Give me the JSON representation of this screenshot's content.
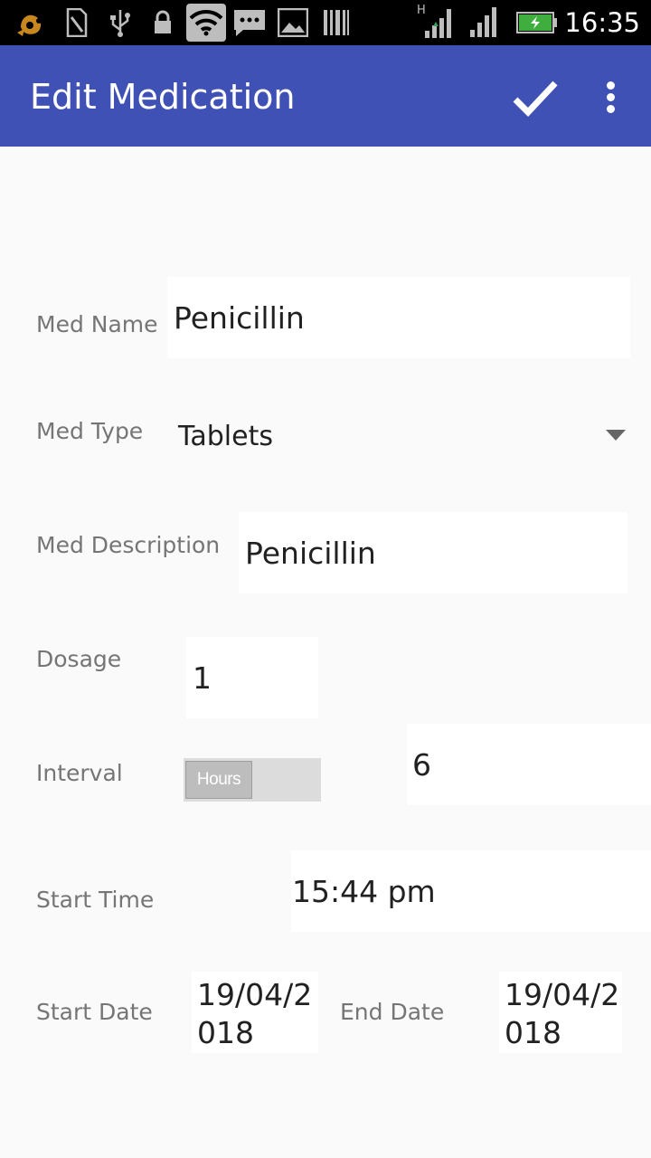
{
  "status_bar": {
    "time": "16:35",
    "icons": [
      "uc-browser-icon",
      "sim-card-icon",
      "usb-icon",
      "lock-icon",
      "wifi-icon",
      "message-icon",
      "image-icon",
      "barcode-icon",
      "signal-h-icon",
      "signal-icon",
      "battery-charging-icon"
    ],
    "network_type": "H"
  },
  "app_bar": {
    "title": "Edit Medication",
    "actions": [
      "check-icon",
      "more-vert-icon"
    ]
  },
  "form": {
    "med_name": {
      "label": "Med Name",
      "value": "Penicillin"
    },
    "med_type": {
      "label": "Med Type",
      "value": "Tablets"
    },
    "med_description": {
      "label": "Med Description",
      "value": "Penicillin"
    },
    "dosage": {
      "label": "Dosage",
      "value": "1"
    },
    "interval": {
      "label": "Interval",
      "toggle_label": "Hours",
      "value": "6"
    },
    "start_time": {
      "label": "Start Time",
      "value": "15:44 pm"
    },
    "start_date": {
      "label": "Start Date",
      "value_line1": "19/04/2",
      "value_line2": "018"
    },
    "end_date": {
      "label": "End Date",
      "value_line1": "19/04/2",
      "value_line2": "018"
    }
  },
  "colors": {
    "app_bar": "#3f51b5",
    "background": "#fafafa",
    "label_text": "#757575",
    "field_text": "#212121"
  }
}
